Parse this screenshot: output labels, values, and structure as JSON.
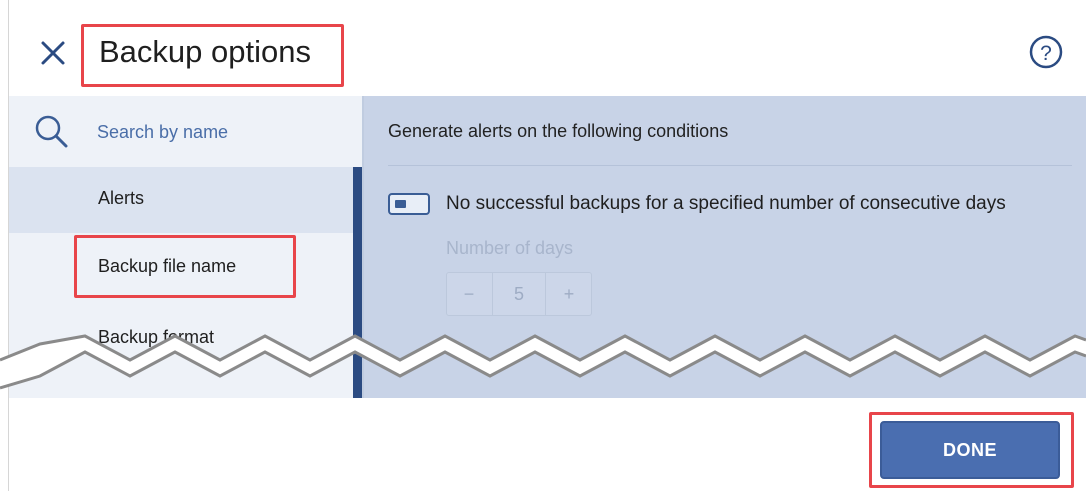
{
  "header": {
    "title": "Backup options",
    "close_icon": "close-icon",
    "help_icon": "help-icon",
    "help_glyph": "?"
  },
  "sidebar": {
    "search": {
      "placeholder": "Search by name",
      "value": "",
      "icon": "search-icon"
    },
    "items": [
      {
        "label": "Alerts",
        "active": true
      },
      {
        "label": "Backup file name",
        "highlighted": true
      },
      {
        "label": "Backup format"
      }
    ]
  },
  "alerts_panel": {
    "heading": "Generate alerts on the following conditions",
    "condition": {
      "label": "No successful backups for a specified number of consecutive days",
      "enabled": false
    },
    "days": {
      "label": "Number of days",
      "value": "5",
      "decrement": "−",
      "increment": "+"
    }
  },
  "footer": {
    "done_label": "DONE"
  },
  "colors": {
    "accent": "#2b4b82",
    "button": "#4a6eb0",
    "highlight": "#e8454a",
    "panel": "#c8d3e7",
    "sidebar": "#eef2f8"
  }
}
